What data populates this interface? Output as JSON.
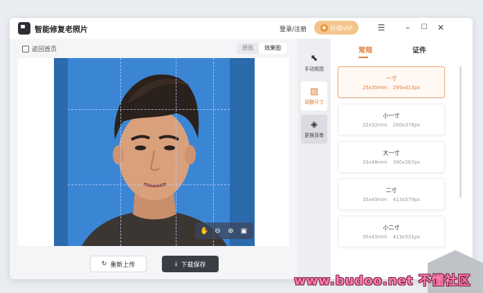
{
  "app": {
    "title": "智能修复老照片"
  },
  "header": {
    "login_label": "登录/注册",
    "vip_label": "升级VIP",
    "menu_icon": "menu-icon",
    "minimize_icon": "minimize-icon",
    "maximize_icon": "maximize-icon",
    "close_icon": "close-icon"
  },
  "left": {
    "back_label": "返回首页",
    "view_original": "原图",
    "view_result": "效果图"
  },
  "actions": {
    "reupload_label": "重新上传",
    "download_label": "下载保存"
  },
  "tools": [
    {
      "label": "手动抠图",
      "icon": "cursor-icon"
    },
    {
      "label": "调整尺寸",
      "icon": "crop-icon"
    },
    {
      "label": "更换背景",
      "icon": "paint-bucket-icon"
    }
  ],
  "tabs": [
    {
      "label": "常规"
    },
    {
      "label": "证件"
    }
  ],
  "sizes": [
    {
      "name": "一寸",
      "mm": "25x35mm",
      "px": "295x413px"
    },
    {
      "name": "小一寸",
      "mm": "22x32mm",
      "px": "260x378px"
    },
    {
      "name": "大一寸",
      "mm": "33x48mm",
      "px": "390x567px"
    },
    {
      "name": "二寸",
      "mm": "35x49mm",
      "px": "413x579px"
    },
    {
      "name": "小二寸",
      "mm": "35x45mm",
      "px": "413x531px"
    }
  ],
  "watermark": "www.budoo.net 不懂社区",
  "colors": {
    "accent": "#e07a36",
    "photo_bg": "#3a86d4",
    "vip": "#f3c58c"
  }
}
